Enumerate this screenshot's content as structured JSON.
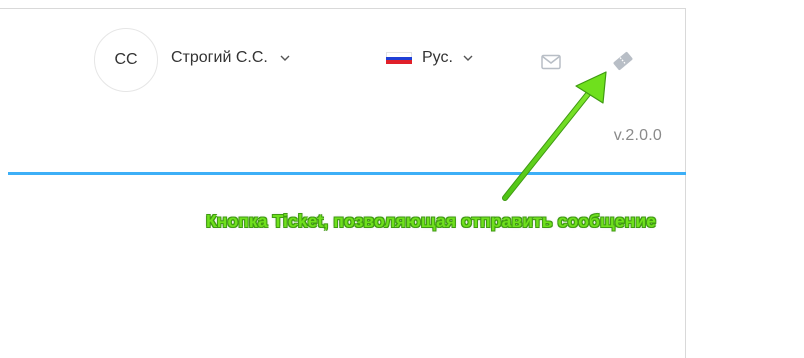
{
  "header": {
    "avatar_initials": "CC",
    "user_name": "Строгий С.С.",
    "language_label": "Рус.",
    "language_flag_colors": [
      "#ffffff",
      "#1f3fd6",
      "#e0202a"
    ],
    "mail_icon": "envelope-icon",
    "ticket_icon": "ticket-icon",
    "version": "v.2.0.0"
  },
  "annotation": {
    "text": "Кнопка Ticket, позволяющая отправить сообщение",
    "color": "#6fe01d"
  },
  "colors": {
    "accent_line": "#3daff7",
    "icon_gray": "#b8bec6"
  }
}
